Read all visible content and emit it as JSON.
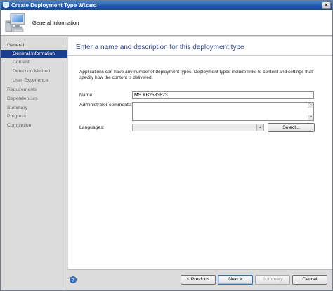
{
  "window": {
    "title": "Create Deployment Type Wizard",
    "close_glyph": "×",
    "icon": "wizard-app-icon"
  },
  "header": {
    "step_title": "General Information",
    "icon": "computer-icon"
  },
  "nav": {
    "items": [
      {
        "label": "General",
        "level": "group",
        "state": "active"
      },
      {
        "label": "General Information",
        "level": "sub",
        "state": "selected"
      },
      {
        "label": "Content",
        "level": "sub",
        "state": "normal"
      },
      {
        "label": "Detection Method",
        "level": "sub",
        "state": "disabled"
      },
      {
        "label": "User Experience",
        "level": "sub",
        "state": "disabled"
      },
      {
        "label": "Requirements",
        "level": "top",
        "state": "disabled"
      },
      {
        "label": "Dependencies",
        "level": "top",
        "state": "disabled"
      },
      {
        "label": "Summary",
        "level": "top",
        "state": "disabled"
      },
      {
        "label": "Progress",
        "level": "top",
        "state": "disabled"
      },
      {
        "label": "Completion",
        "level": "top",
        "state": "disabled"
      }
    ]
  },
  "main": {
    "heading": "Enter a name and description for this deployment type",
    "description": "Applications can have any number of deployment types. Deployment types include links to content and settings that specify how the content is delivered.",
    "name_label": "Name:",
    "name_value": "MS KB2533623",
    "comments_label": "Administrator comments:",
    "comments_value": "",
    "languages_label": "Languages:",
    "languages_value": "",
    "select_button": "Select..."
  },
  "footer": {
    "help_icon": "help-icon",
    "previous": "< Previous",
    "next": "Next >",
    "summary": "Summary",
    "cancel": "Cancel"
  },
  "colors": {
    "accent": "#1c3f8d",
    "heading": "#2a3f88",
    "titlebar": "#1f55a8"
  }
}
